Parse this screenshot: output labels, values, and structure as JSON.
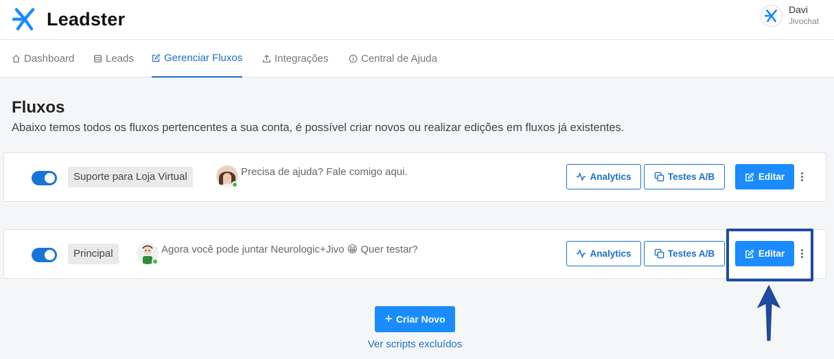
{
  "brand": {
    "name": "Leadster",
    "accent": "#1a8cff"
  },
  "user": {
    "name": "Davi",
    "company": "Jivochat"
  },
  "nav": {
    "items": [
      {
        "label": "Dashboard",
        "icon": "home-icon"
      },
      {
        "label": "Leads",
        "icon": "database-icon"
      },
      {
        "label": "Gerenciar Fluxos",
        "icon": "edit-icon",
        "active": true
      },
      {
        "label": "Integrações",
        "icon": "upload-icon"
      },
      {
        "label": "Central de Ajuda",
        "icon": "info-icon"
      }
    ]
  },
  "page": {
    "title": "Fluxos",
    "subtitle": "Abaixo temos todos os fluxos pertencentes a sua conta, é possível criar novos ou realizar edições em fluxos já existentes."
  },
  "flows": [
    {
      "enabled": true,
      "name": "Suporte para Loja Virtual",
      "greeting": "Precisa de ajuda? Fale comigo aqui.",
      "online": true
    },
    {
      "enabled": true,
      "name": "Principal",
      "greeting": "Agora você pode juntar Neurologic+Jivo 😁 Quer testar?",
      "online": true
    }
  ],
  "actions": {
    "analytics_label": "Analytics",
    "ab_label": "Testes A/B",
    "edit_label": "Editar"
  },
  "footer": {
    "create_label": "Criar Novo",
    "deleted_link": "Ver scripts excluídos"
  }
}
